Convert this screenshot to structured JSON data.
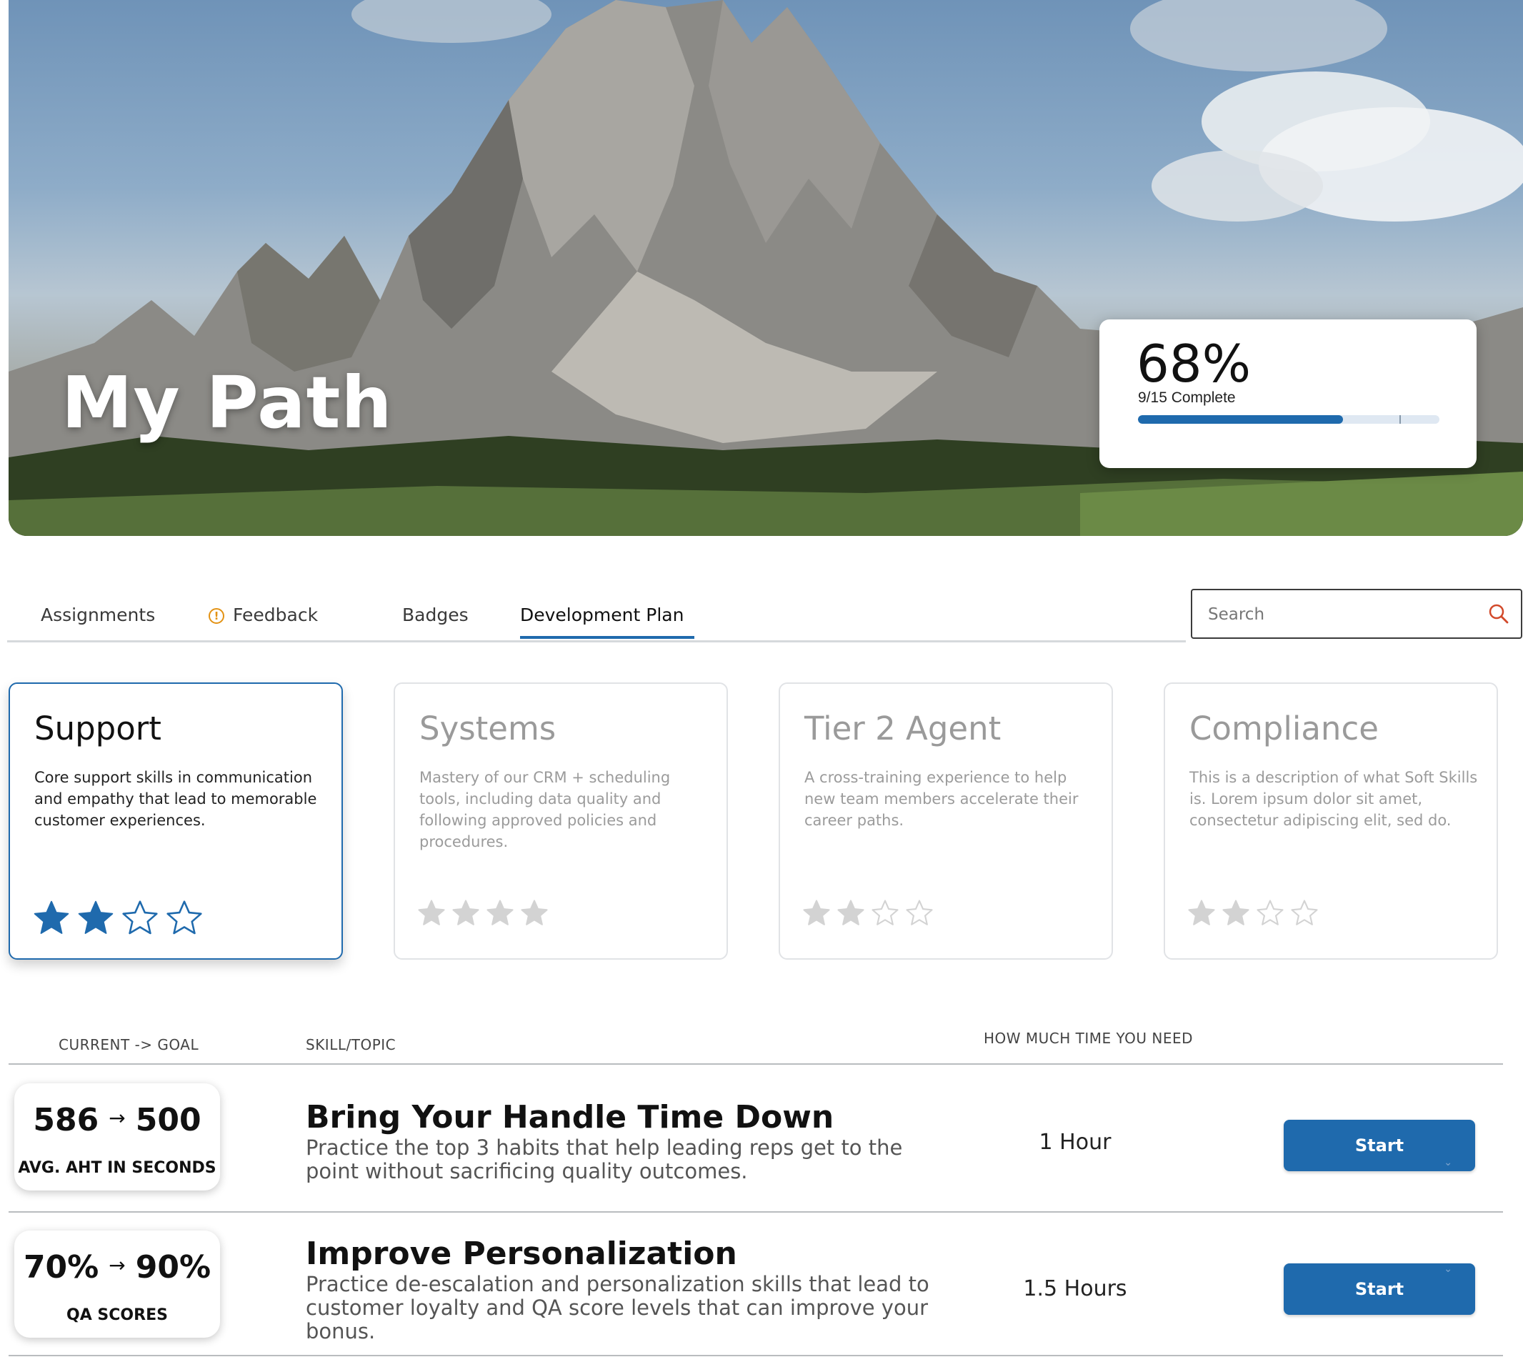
{
  "hero": {
    "title": "My Path",
    "progress": {
      "percent_label": "68%",
      "count_label": "9/15 Complete",
      "fraction": 0.68
    }
  },
  "tabs": [
    {
      "label": "Assignments",
      "active": false
    },
    {
      "label": "Feedback",
      "active": false,
      "icon": "alert-circle-icon"
    },
    {
      "label": "Badges",
      "active": false
    },
    {
      "label": "Development Plan",
      "active": true
    }
  ],
  "search": {
    "placeholder": "Search",
    "icon": "search-icon"
  },
  "skills": [
    {
      "title": "Support",
      "description": "Core support skills in communication and empathy that lead to memorable customer experiences.",
      "stars_filled": 2,
      "stars_total": 4,
      "selected": true
    },
    {
      "title": "Systems",
      "description": "Mastery of our CRM + scheduling tools, including data quality and following approved policies and procedures.",
      "stars_filled": 4,
      "stars_total": 4,
      "selected": false
    },
    {
      "title": "Tier 2 Agent",
      "description": "A cross-training experience to help new team members accelerate their career paths.",
      "stars_filled": 2,
      "stars_total": 4,
      "selected": false
    },
    {
      "title": "Compliance",
      "description": "This is a description of what Soft Skills is. Lorem ipsum dolor sit amet, consectetur adipiscing elit, sed do.",
      "stars_filled": 2,
      "stars_total": 4,
      "selected": false
    }
  ],
  "table": {
    "headers": {
      "current_goal": "CURRENT -> GOAL",
      "skill_topic": "SKILL/TOPIC",
      "time_needed": "HOW MUCH TIME YOU NEED"
    },
    "rows": [
      {
        "current": "586",
        "arrow": "→",
        "goal": "500",
        "metric_label": "AVG. AHT IN SECONDS",
        "title": "Bring Your Handle Time Down",
        "description": "Practice the top 3 habits that help leading reps get to the point without sacrificing quality outcomes.",
        "duration": "1 Hour",
        "button_label": "Start"
      },
      {
        "current": "70%",
        "arrow": "→",
        "goal": "90%",
        "metric_label": "QA SCORES",
        "title": "Improve Personalization",
        "description": "Practice de-escalation and personalization skills that lead to customer loyalty and QA score levels that can improve your bonus.",
        "duration": "1.5 Hours",
        "button_label": "Start"
      }
    ]
  },
  "colors": {
    "accent": "#1f6aad",
    "warning": "#e39214",
    "search_icon": "#d2492a",
    "star_inactive": "#d3d3d3"
  }
}
